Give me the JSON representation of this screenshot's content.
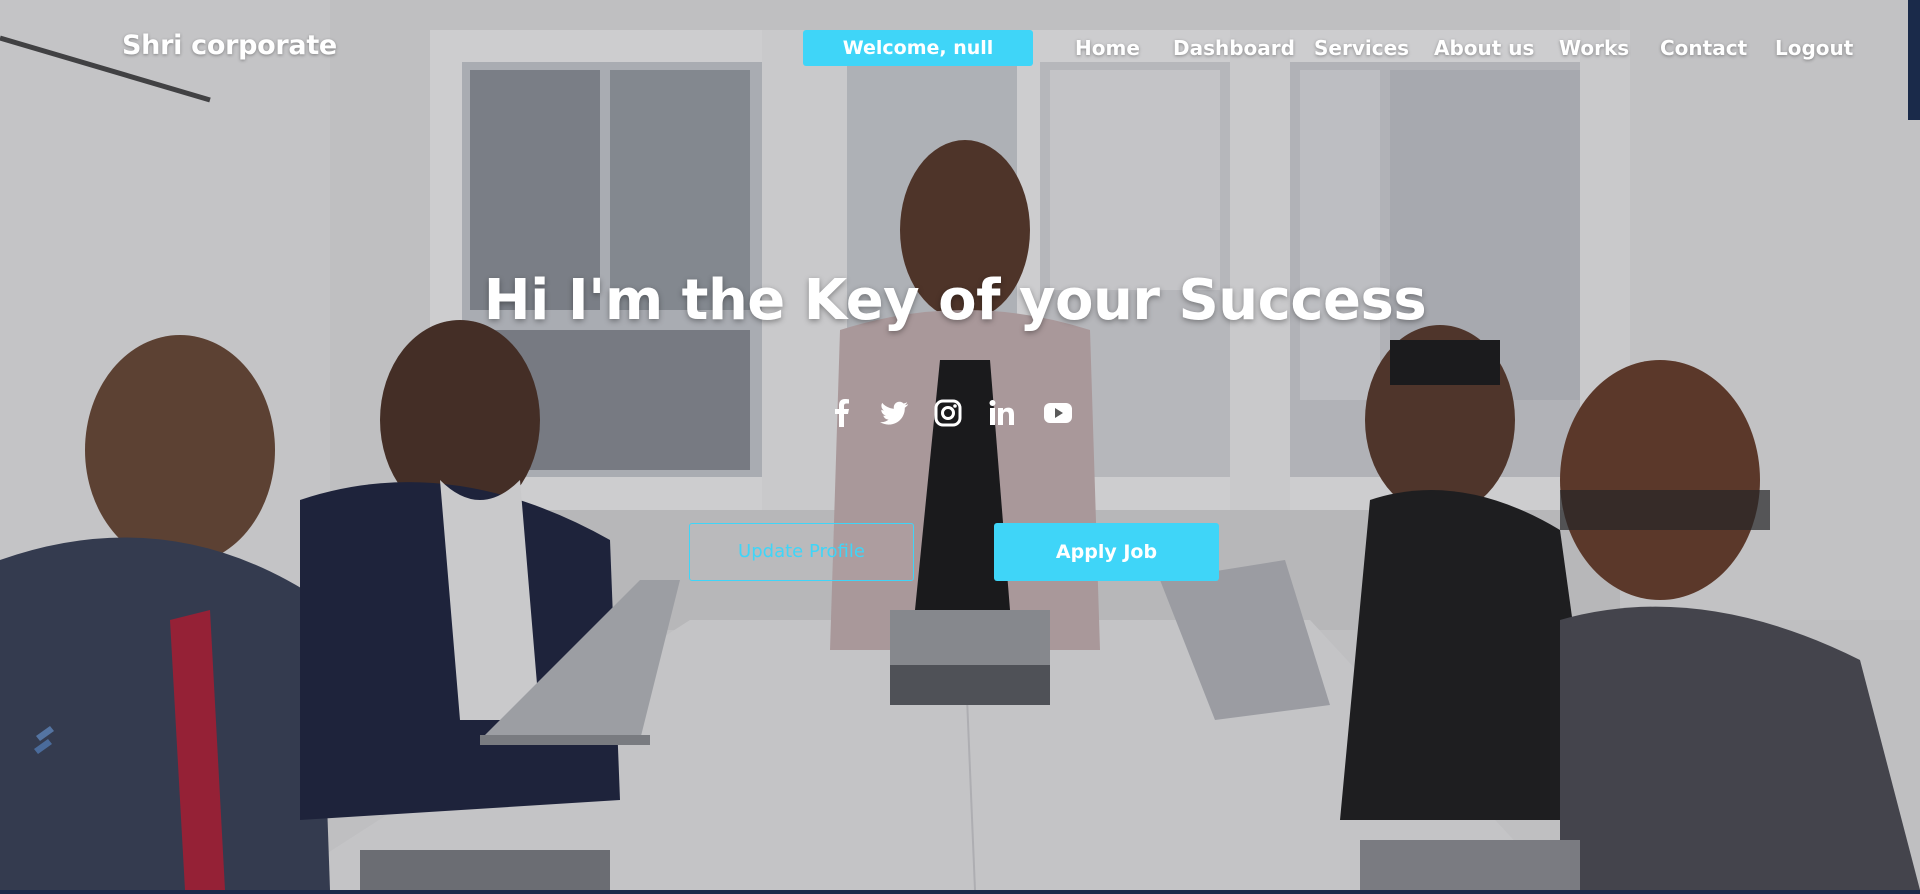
{
  "header": {
    "brand": "Shri corporate",
    "welcome": "Welcome, null"
  },
  "nav": {
    "items": [
      "Home",
      "Dashboard",
      "Services",
      "About us",
      "Works",
      "Contact",
      "Logout"
    ]
  },
  "hero": {
    "headline": "Hi I'm the Key of your Success",
    "social_icons": [
      "facebook-icon",
      "twitter-icon",
      "instagram-icon",
      "linkedin-icon",
      "youtube-icon"
    ],
    "buttons": {
      "update_profile": "Update Profile",
      "apply_job": "Apply Job"
    }
  },
  "colors": {
    "accent": "#3fd5f8",
    "text": "#ffffff"
  }
}
